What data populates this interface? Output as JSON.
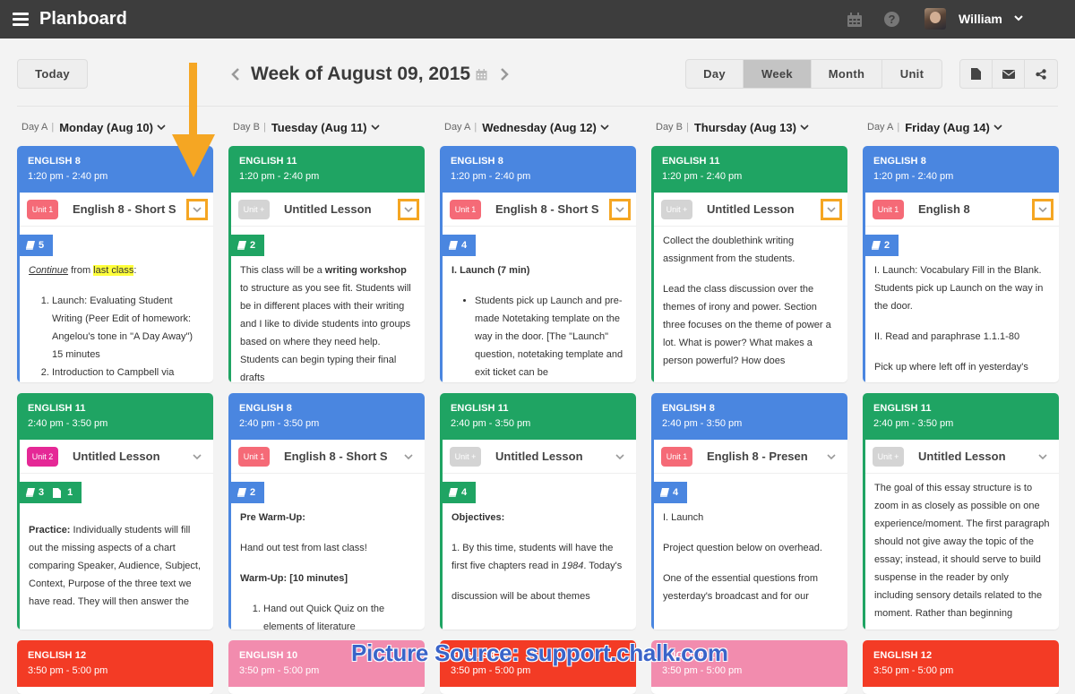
{
  "app": {
    "title": "Planboard",
    "user": "William"
  },
  "toolbar": {
    "today_label": "Today",
    "week_title": "Week of August 09, 2015",
    "views": [
      {
        "label": "Day",
        "active": false
      },
      {
        "label": "Week",
        "active": true
      },
      {
        "label": "Month",
        "active": false
      },
      {
        "label": "Unit",
        "active": false
      }
    ],
    "actions": [
      "document-icon",
      "email-icon",
      "share-icon"
    ]
  },
  "colors": {
    "blue": "#4a86e0",
    "green": "#1fa463",
    "red": "#f33b25",
    "pink": "#f28cae",
    "unit1": "#f56a77",
    "unit2": "#e52896",
    "unit_empty": "#d4d4d4",
    "highlight": "#f5a623"
  },
  "days": [
    {
      "day_ab": "Day A",
      "name": "Monday (Aug 10)"
    },
    {
      "day_ab": "Day B",
      "name": "Tuesday (Aug 11)"
    },
    {
      "day_ab": "Day A",
      "name": "Wednesday (Aug 12)"
    },
    {
      "day_ab": "Day B",
      "name": "Thursday (Aug 13)"
    },
    {
      "day_ab": "Day A",
      "name": "Friday (Aug 14)"
    }
  ],
  "row1": [
    {
      "cls": "ENGLISH 8",
      "time": "1:20 pm - 2:40 pm",
      "color": "blue",
      "unit": "Unit 1",
      "lesson": "English 8 - Short S",
      "count": "5",
      "text": [
        "Continue",
        " from ",
        "last class",
        ":",
        "Launch: Evaluating Student Writing (Peer Edit of homework: Angelou's tone in \"A Day Away\") 15 minutes",
        "Introduction to Campbell via"
      ]
    },
    {
      "cls": "ENGLISH 11",
      "time": "1:20 pm - 2:40 pm",
      "color": "green",
      "unit": "Unit +",
      "lesson": "Untitled Lesson",
      "count": "2",
      "text": [
        "This class will be a ",
        "writing workshop",
        " to structure as you see fit. Students will be in different places with their writing and I like to divide students into groups based on where they need help. Students can begin typing their final drafts"
      ]
    },
    {
      "cls": "ENGLISH 8",
      "time": "1:20 pm - 2:40 pm",
      "color": "blue",
      "unit": "Unit 1",
      "lesson": "English 8 - Short S",
      "count": "4",
      "text": [
        "I. Launch (7 min)",
        "Students pick up Launch and pre-made Notetaking template on the way in the door. [The \"Launch\" question, notetaking template and exit ticket can be"
      ]
    },
    {
      "cls": "ENGLISH 11",
      "time": "1:20 pm - 2:40 pm",
      "color": "green",
      "unit": "Unit +",
      "lesson": "Untitled Lesson",
      "text": [
        "Collect the doublethink writing assignment from the students.",
        "Lead the class discussion over the themes of irony and power. Section three focuses on the theme of power a lot. What is power? What makes a person powerful? How does"
      ]
    },
    {
      "cls": "ENGLISH 8",
      "time": "1:20 pm - 2:40 pm",
      "color": "blue",
      "unit": "Unit 1",
      "lesson": "English 8",
      "count": "2",
      "text": [
        "I. Launch: Vocabulary Fill in the Blank. Students pick up Launch on the way in the door.",
        "II. Read and paraphrase 1.1.1-80",
        "Pick up where left off in yesterday's"
      ]
    }
  ],
  "row2": [
    {
      "cls": "ENGLISH 11",
      "time": "2:40 pm - 3:50 pm",
      "color": "green",
      "unit": "Unit 2",
      "lesson": "Untitled Lesson",
      "count": "3",
      "count2": "1",
      "text": [
        "Practice:",
        " Individually students will fill out the missing aspects of a chart comparing Speaker, Audience, Subject, Context, Purpose of the three text we have read. They will then answer the"
      ]
    },
    {
      "cls": "ENGLISH 8",
      "time": "2:40 pm - 3:50 pm",
      "color": "blue",
      "unit": "Unit 1",
      "lesson": "English 8 - Short S",
      "count": "2",
      "text": [
        "Pre Warm-Up:",
        "Hand out test from last class!",
        "Warm-Up: [10 minutes]",
        "Hand out Quick Quiz on the elements of literature"
      ]
    },
    {
      "cls": "ENGLISH 11",
      "time": "2:40 pm - 3:50 pm",
      "color": "green",
      "unit": "Unit +",
      "lesson": "Untitled Lesson",
      "count": "4",
      "text": [
        "Objectives:",
        "1. By this time, students will have the first five chapters read in ",
        "1984",
        ". Today's",
        "discussion will be about themes"
      ]
    },
    {
      "cls": "ENGLISH 8",
      "time": "2:40 pm - 3:50 pm",
      "color": "blue",
      "unit": "Unit 1",
      "lesson": "English 8 - Presen",
      "count": "4",
      "text": [
        "I. Launch",
        "Project question below on overhead.",
        "One of the essential questions from yesterday's broadcast and for our"
      ]
    },
    {
      "cls": "ENGLISH 11",
      "time": "2:40 pm - 3:50 pm",
      "color": "green",
      "unit": "Unit +",
      "lesson": "Untitled Lesson",
      "text": [
        "The goal of this essay structure is to zoom in as closely as possible on one experience/moment. The first paragraph should not give away the topic of the essay; instead, it should serve to build suspense in the reader by only including sensory details related to the moment. Rather than beginning"
      ]
    }
  ],
  "row3": [
    {
      "cls": "ENGLISH 12",
      "time": "3:50 pm - 5:00 pm",
      "color": "red"
    },
    {
      "cls": "ENGLISH 10",
      "time": "3:50 pm - 5:00 pm",
      "color": "pink"
    },
    {
      "cls": "ENGLISH 12",
      "time": "3:50 pm - 5:00 pm",
      "color": "red"
    },
    {
      "cls": "ENGLISH 10",
      "time": "3:50 pm - 5:00 pm",
      "color": "pink"
    },
    {
      "cls": "ENGLISH 12",
      "time": "3:50 pm - 5:00 pm",
      "color": "red"
    }
  ],
  "watermark": "Picture Source: support.chalk.com"
}
